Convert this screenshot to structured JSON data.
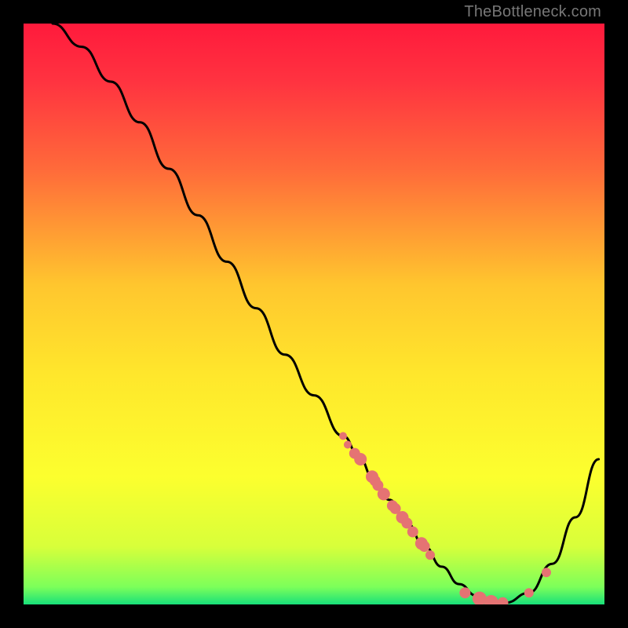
{
  "attribution": "TheBottleneck.com",
  "gradient": {
    "stops": [
      {
        "offset": 0.0,
        "color": "#ff1a3c"
      },
      {
        "offset": 0.1,
        "color": "#ff3340"
      },
      {
        "offset": 0.25,
        "color": "#ff6a3a"
      },
      {
        "offset": 0.45,
        "color": "#ffc62e"
      },
      {
        "offset": 0.6,
        "color": "#ffe62c"
      },
      {
        "offset": 0.78,
        "color": "#fcff2e"
      },
      {
        "offset": 0.9,
        "color": "#d8ff3a"
      },
      {
        "offset": 0.97,
        "color": "#7cff5a"
      },
      {
        "offset": 1.0,
        "color": "#18e07a"
      }
    ]
  },
  "chart_data": {
    "type": "line",
    "title": "",
    "xlabel": "",
    "ylabel": "",
    "xlim": [
      0,
      100
    ],
    "ylim": [
      0,
      100
    ],
    "series": [
      {
        "name": "curve",
        "x": [
          5,
          10,
          15,
          20,
          25,
          30,
          35,
          40,
          45,
          50,
          55,
          58,
          60,
          63,
          66,
          69,
          72,
          75,
          78,
          80,
          83,
          87,
          91,
          95,
          99
        ],
        "y": [
          100,
          96,
          90,
          83,
          75,
          67,
          59,
          51,
          43,
          36,
          29,
          25,
          22,
          18,
          14,
          10,
          6.5,
          3.5,
          1.5,
          0.6,
          0.3,
          2,
          7,
          15,
          25
        ]
      }
    ],
    "markers": {
      "name": "highlighted-points",
      "color": "#e57373",
      "x": [
        55,
        55.8,
        57,
        58,
        60,
        60.5,
        61,
        62,
        63.5,
        64,
        65.2,
        66,
        67,
        68.5,
        69,
        70,
        76,
        78.5,
        80.5,
        82.5,
        87,
        90
      ],
      "y": [
        29,
        27.5,
        26,
        25,
        22,
        21.3,
        20.5,
        19,
        17,
        16.5,
        15,
        14,
        12.5,
        10.5,
        10,
        8.5,
        2,
        1,
        0.4,
        0.3,
        2.0,
        5.5
      ],
      "r": [
        5,
        5,
        7,
        8,
        8,
        7,
        7,
        8,
        7,
        7,
        8,
        7,
        7,
        8,
        7,
        6,
        7,
        9,
        9,
        7,
        6,
        6
      ]
    }
  }
}
